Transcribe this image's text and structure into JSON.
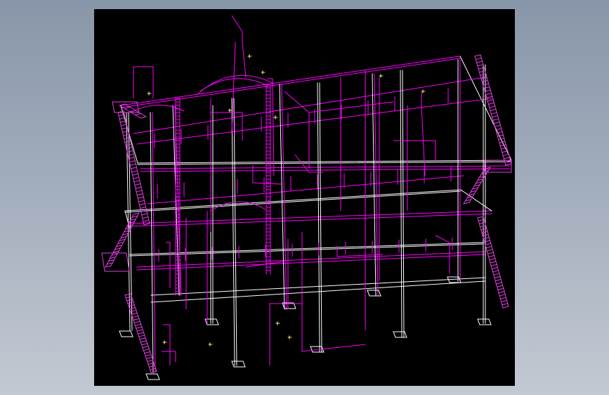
{
  "app": {
    "name": "",
    "title": ""
  },
  "drawing": {
    "background": "#000000",
    "page_background": "#9aa5b5",
    "colors": {
      "steel": "#ffffff",
      "piping": "#ff00ff",
      "stairs": "#e23fe2",
      "footing": "#ffffff",
      "annotation": "#ffd200"
    },
    "icons": {
      "structure": "steel-frame-icon",
      "pipe": "pipe-run-icon",
      "stair": "stair-flight-icon",
      "footing": "base-plate-icon"
    }
  }
}
